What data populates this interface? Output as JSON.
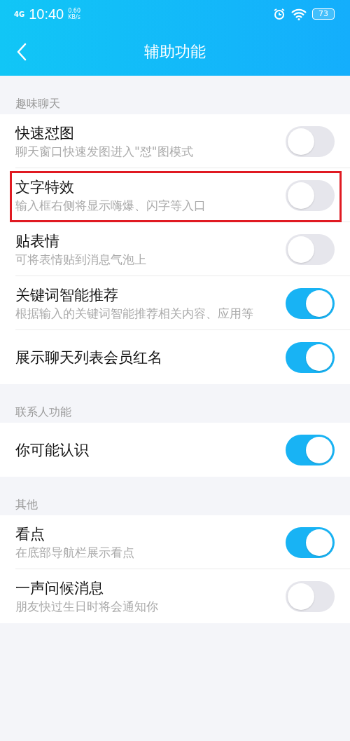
{
  "status_bar": {
    "network": "4G",
    "time": "10:40",
    "speed": "0.60",
    "speed_unit": "KB/s",
    "battery": "73"
  },
  "header": {
    "title": "辅助功能"
  },
  "sections": [
    {
      "title": "趣味聊天",
      "items": [
        {
          "title": "快速怼图",
          "subtitle": "聊天窗口快速发图进入\"怼\"图模式",
          "on": false,
          "highlighted": false
        },
        {
          "title": "文字特效",
          "subtitle": "输入框右侧将显示嗨爆、闪字等入口",
          "on": false,
          "highlighted": true
        },
        {
          "title": "贴表情",
          "subtitle": "可将表情贴到消息气泡上",
          "on": false,
          "highlighted": false
        },
        {
          "title": "关键词智能推荐",
          "subtitle": "根据输入的关键词智能推荐相关内容、应用等",
          "on": true,
          "highlighted": false
        },
        {
          "title": "展示聊天列表会员红名",
          "on": true,
          "highlighted": false
        }
      ]
    },
    {
      "title": "联系人功能",
      "items": [
        {
          "title": "你可能认识",
          "on": true,
          "highlighted": false
        }
      ]
    },
    {
      "title": "其他",
      "items": [
        {
          "title": "看点",
          "subtitle": "在底部导航栏展示看点",
          "on": true,
          "highlighted": false
        },
        {
          "title": "一声问候消息",
          "subtitle": "朋友快过生日时将会通知你",
          "on": false,
          "highlighted": false
        }
      ]
    }
  ]
}
